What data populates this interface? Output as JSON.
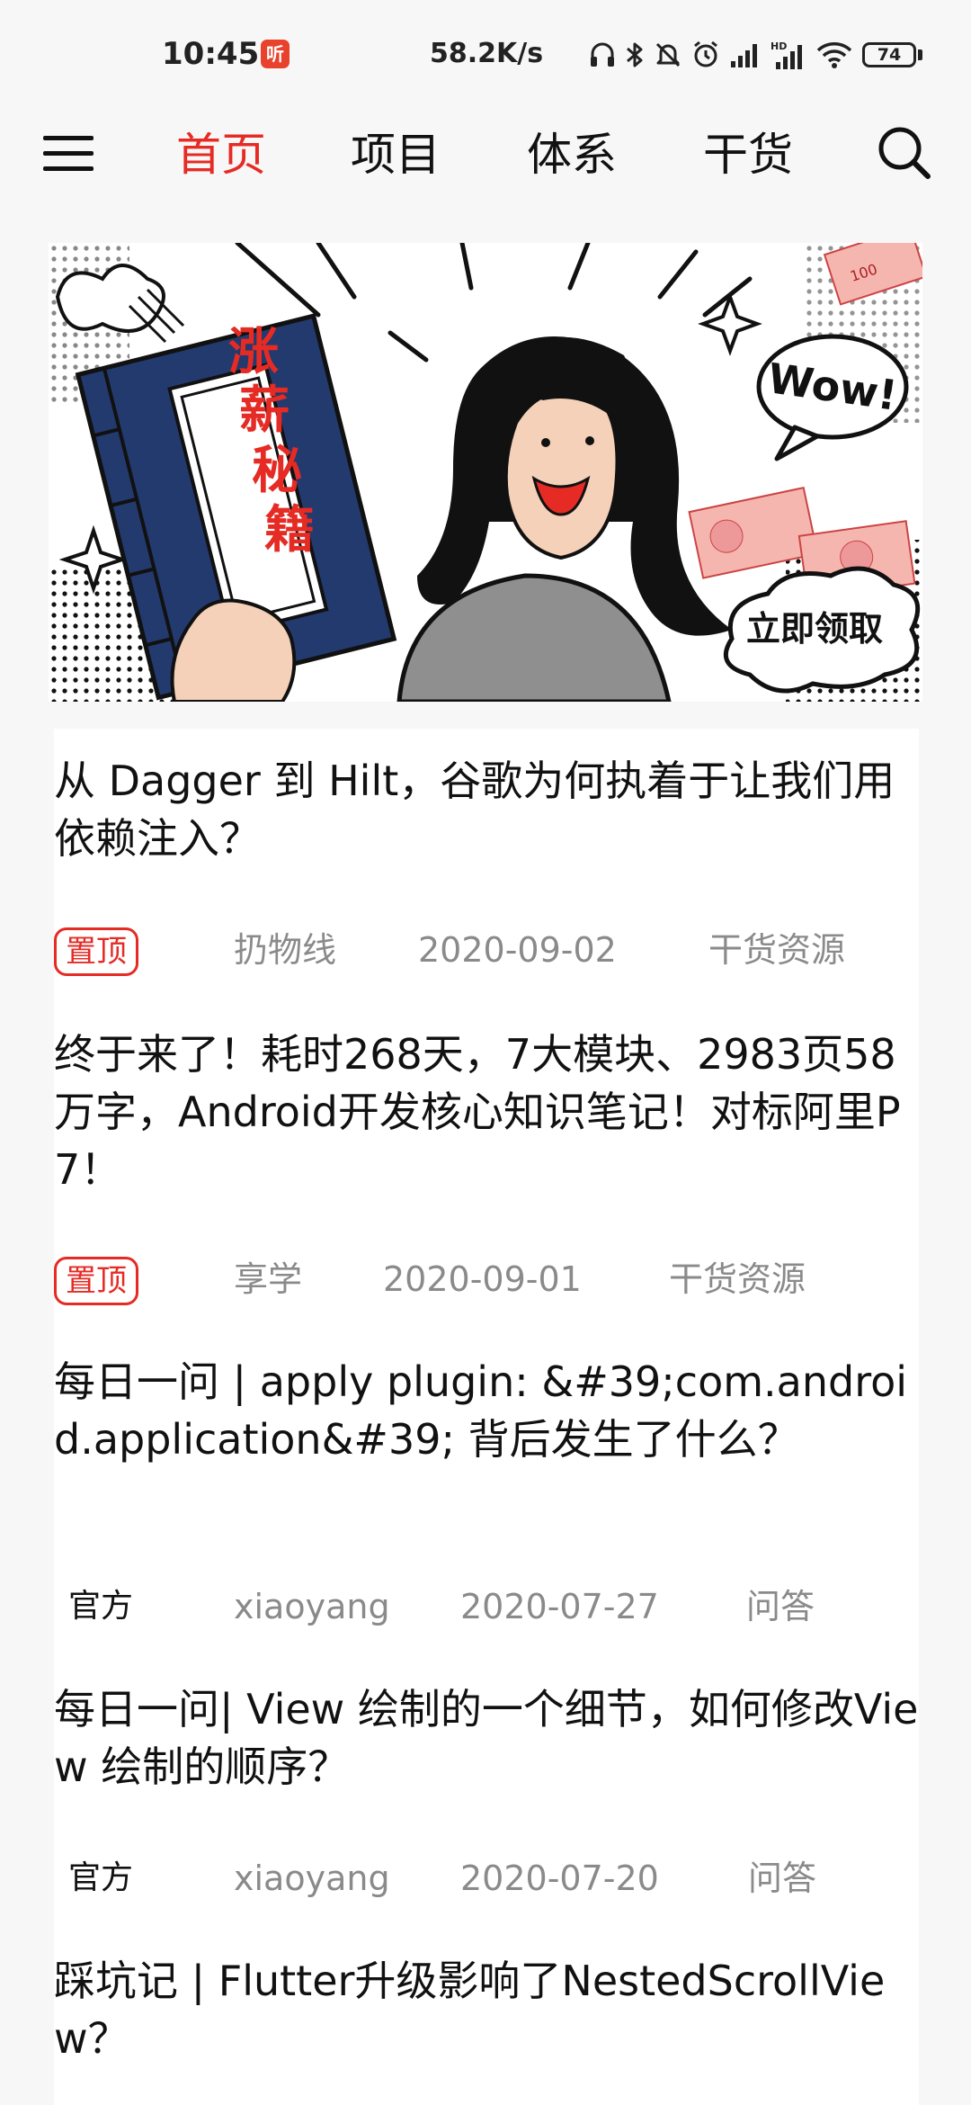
{
  "status_bar": {
    "time": "10:45",
    "app_icon_text": "听",
    "net_speed": "58.2K/s",
    "battery": "74",
    "icons": [
      "headphones-icon",
      "bluetooth-icon",
      "mute-icon",
      "alarm-icon",
      "signal-icon",
      "hd-signal-icon",
      "wifi-icon",
      "battery-icon"
    ]
  },
  "toolbar": {
    "tabs": [
      {
        "label": "首页",
        "active": true
      },
      {
        "label": "项目",
        "active": false
      },
      {
        "label": "体系",
        "active": false
      },
      {
        "label": "干货",
        "active": false
      }
    ]
  },
  "banner": {
    "book_title": "涨薪秘籍",
    "speech": "Wow!",
    "cta": "立即领取",
    "money_label": "100"
  },
  "colors": {
    "accent": "#e52b24",
    "meta_text": "#8a8a8a",
    "book_blue": "#233a6e"
  },
  "articles": [
    {
      "title": "从 Dagger 到 Hilt，谷歌为何执着于让我们用依赖注入？",
      "tag": "置顶",
      "author": "扔物线",
      "date": "2020-09-02",
      "category": "干货资源"
    },
    {
      "title": "终于来了！耗时268天，7大模块、2983页58万字，Android开发核心知识笔记！对标阿里P7！",
      "tag": "置顶",
      "author": "享学",
      "date": "2020-09-01",
      "category": "干货资源"
    },
    {
      "title": "每日一问 | apply plugin: &#39;com.android.application&#39; 背后发生了什么？",
      "tag": "官方",
      "author": "xiaoyang",
      "date": "2020-07-27",
      "category": "问答"
    },
    {
      "title": "每日一问| View 绘制的一个细节，如何修改View 绘制的顺序？",
      "tag": "官方",
      "author": "xiaoyang",
      "date": "2020-07-20",
      "category": "问答"
    },
    {
      "title": "踩坑记 | Flutter升级影响了NestedScrollView？",
      "tag": "",
      "author": "",
      "date": "",
      "category": ""
    }
  ]
}
